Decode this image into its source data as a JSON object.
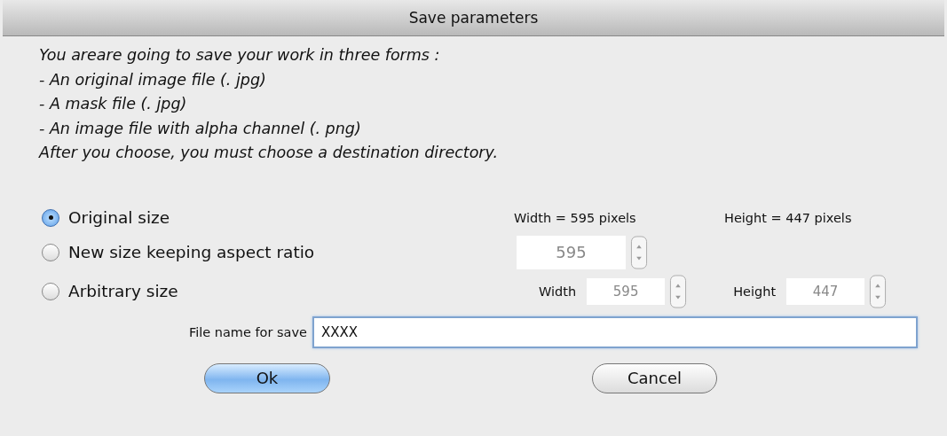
{
  "window": {
    "title": "Save parameters"
  },
  "intro_lines": [
    "You areare going to save your work in three forms :",
    "- An original image file (. jpg)",
    "- A mask file (. jpg)",
    "- An image file with alpha channel (. png)",
    "After you choose, you must choose a destination directory."
  ],
  "size_options": [
    {
      "label": "Original size",
      "selected": true
    },
    {
      "label": "New size keeping aspect ratio",
      "selected": false
    },
    {
      "label": "Arbitrary size",
      "selected": false
    }
  ],
  "original_size": {
    "width_text": "Width = 595 pixels",
    "height_text": "Height = 447 pixels"
  },
  "aspect_field": {
    "value": "595",
    "disabled": true
  },
  "arbitrary": {
    "width_label": "Width",
    "width_value": "595",
    "height_label": "Height",
    "height_value": "447",
    "disabled": true
  },
  "file_name": {
    "label": "File name for save",
    "value": "XXXX"
  },
  "buttons": [
    {
      "label": "Ok",
      "default": true
    },
    {
      "label": "Cancel",
      "default": false
    }
  ]
}
